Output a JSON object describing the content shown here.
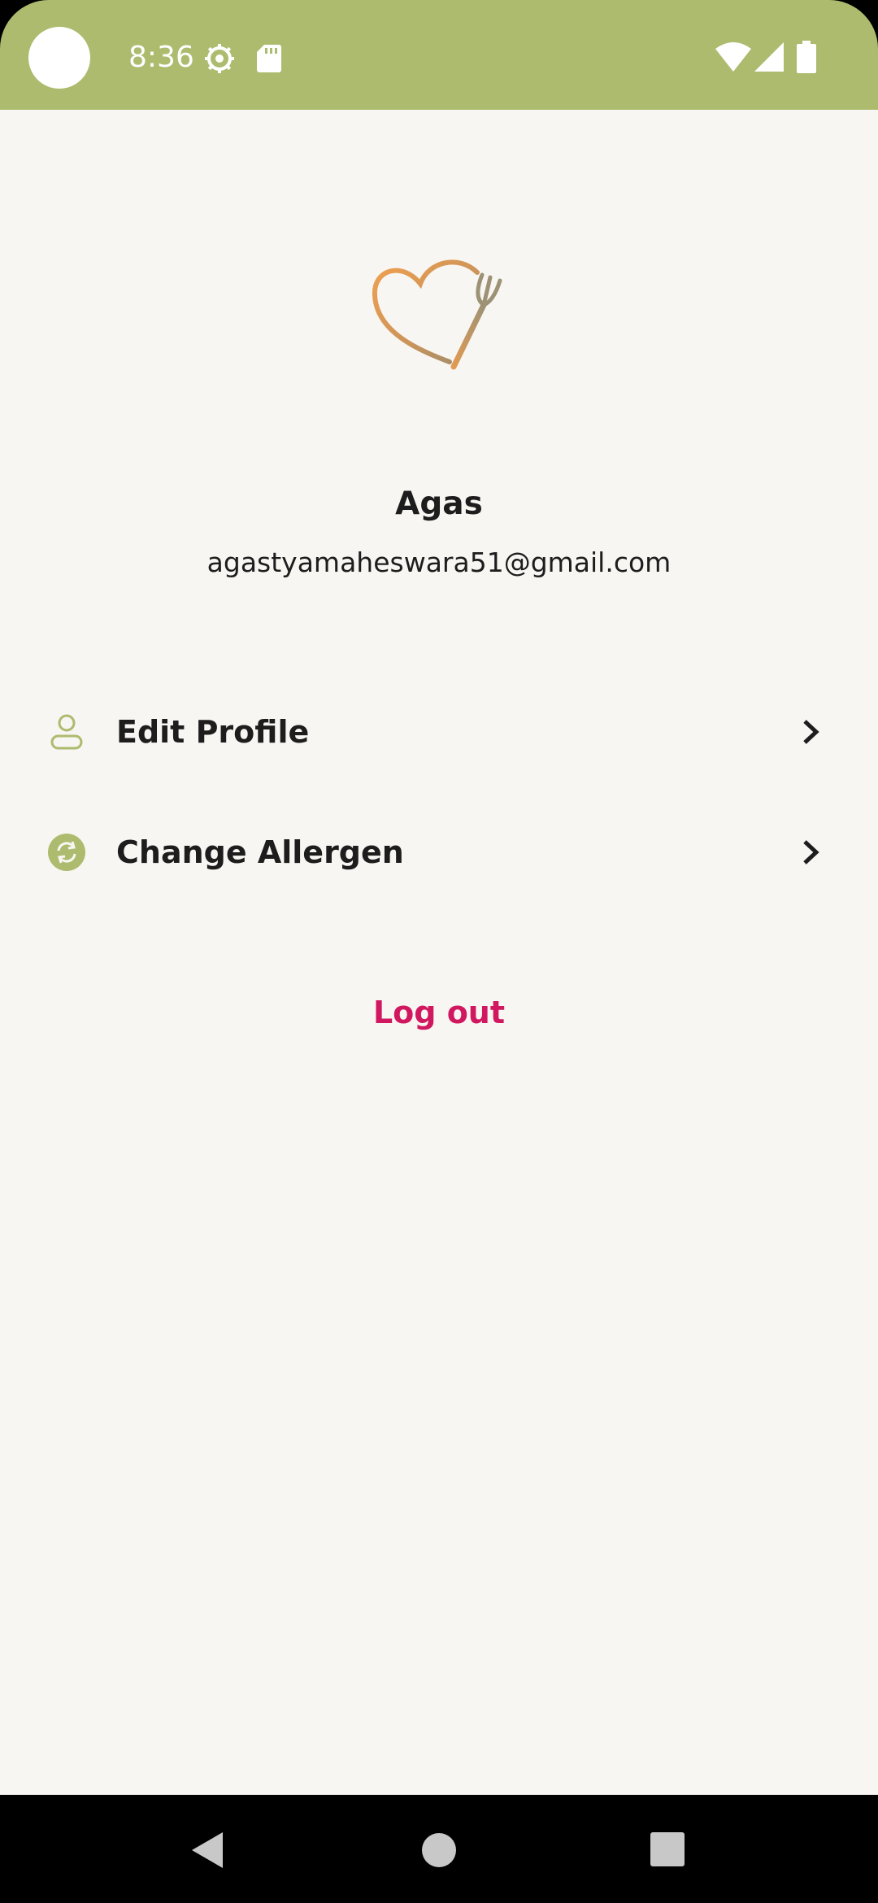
{
  "status_bar": {
    "time": "8:36",
    "background_color": "#adbb6f",
    "icons": [
      "settings-gear-icon",
      "sd-card-icon",
      "wifi-icon",
      "cellular-signal-icon",
      "battery-icon"
    ]
  },
  "app": {
    "logo": "heart-fork-logo",
    "user": {
      "name": "Agas",
      "email": "agastyamaheswara51@gmail.com"
    },
    "menu": [
      {
        "label": "Edit Profile",
        "icon": "person-icon"
      },
      {
        "label": "Change Allergen",
        "icon": "sync-icon"
      }
    ],
    "logout_label": "Log out",
    "colors": {
      "accent": "#adbb6f",
      "logout": "#d0175f",
      "background": "#f8f6f2"
    }
  },
  "navigation": {
    "buttons": [
      "back-icon",
      "home-icon",
      "recents-icon"
    ]
  }
}
